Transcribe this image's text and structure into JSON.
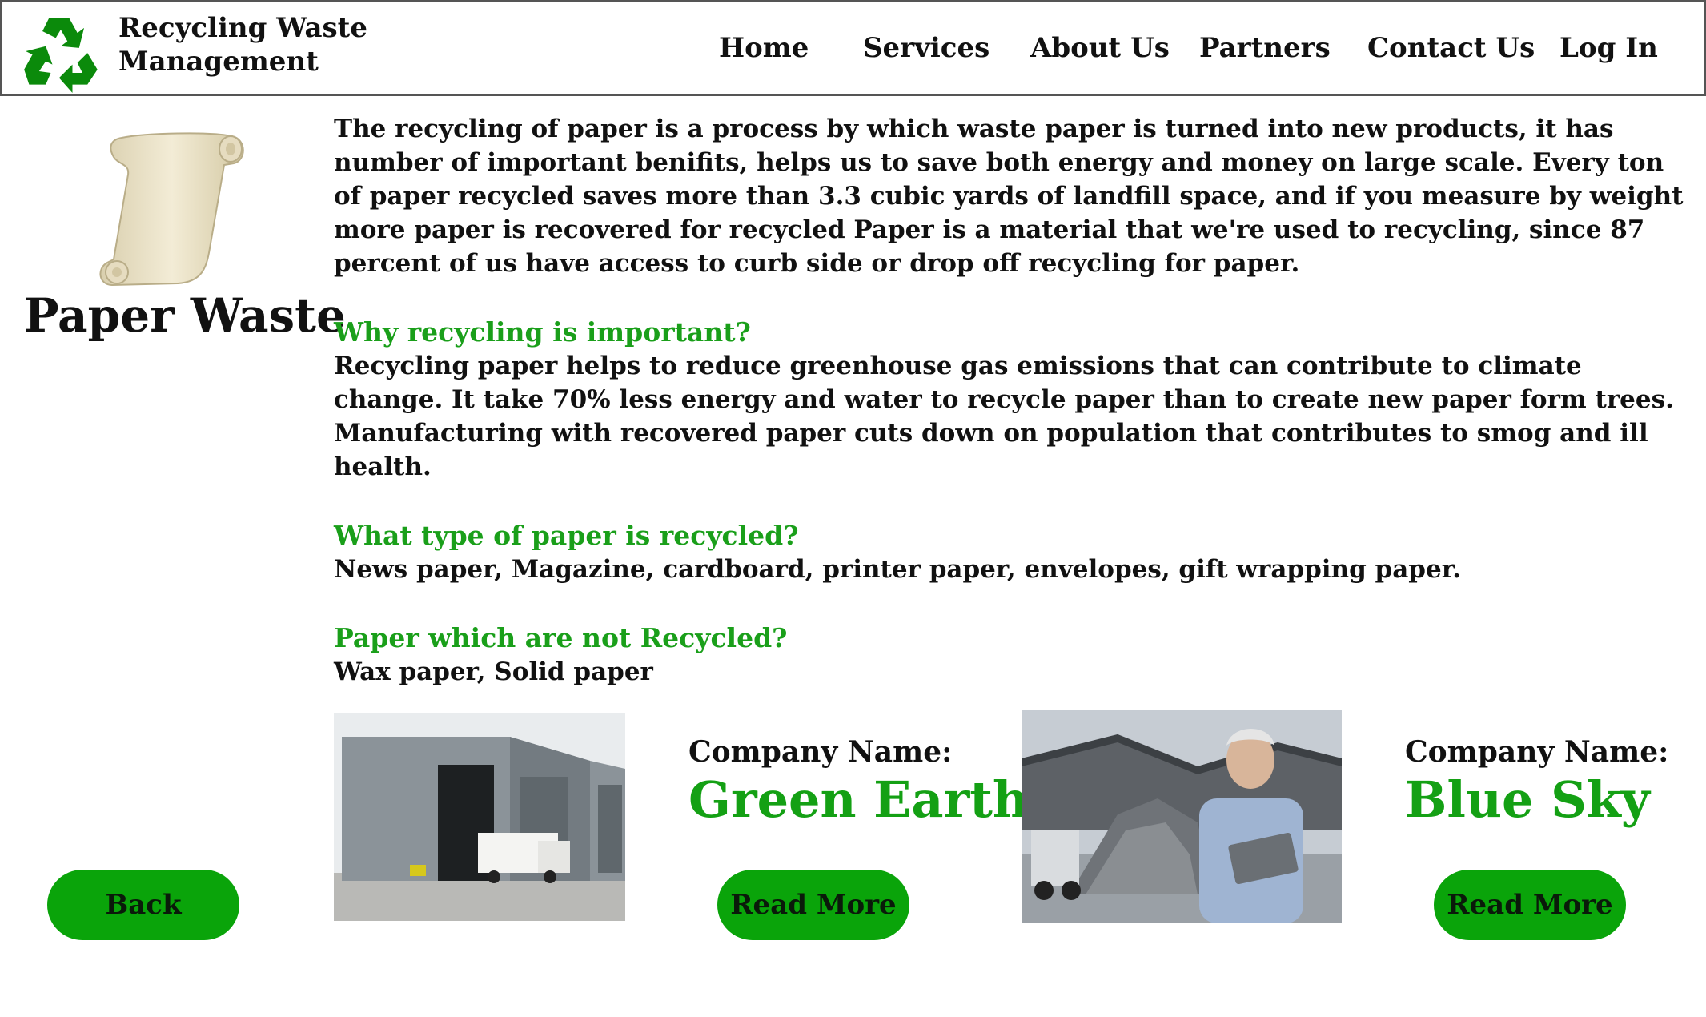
{
  "brand": {
    "line1": "Recycling Waste",
    "line2": "Management"
  },
  "nav": [
    "Home",
    "Services",
    "About Us",
    "Partners",
    "Contact Us",
    "Log In"
  ],
  "page_title": "Paper Waste",
  "intro": "The recycling of paper is a process by which waste paper is turned into new products, it has number of important benifits, helps us to save both energy and money on large scale.  Every ton of paper recycled saves more than 3.3 cubic yards of landfill space, and if you measure by weight more paper is recovered for recycled Paper is a material that we're used to recycling, since 87 percent of us have access to curb side or drop off recycling for paper.",
  "sections": [
    {
      "heading": "Why recycling is important?",
      "text": "Recycling paper helps to reduce greenhouse gas emissions that can contribute to climate change. It take 70% less energy and water to recycle paper than to create new paper form trees. Manufacturing with recovered paper cuts down on population that contributes to smog and ill health."
    },
    {
      "heading": "What type of paper is recycled?",
      "text": "News paper, Magazine, cardboard, printer paper, envelopes, gift wrapping paper."
    },
    {
      "heading": "Paper which are not Recycled?",
      "text": "Wax paper, Solid paper"
    }
  ],
  "companies": [
    {
      "label": "Company Name:",
      "name": "Green Earth",
      "button": "Read More"
    },
    {
      "label": "Company Name:",
      "name": "Blue Sky",
      "button": "Read More"
    }
  ],
  "back_button": "Back",
  "colors": {
    "accent_green": "#14a014",
    "button_green": "#0aa40a",
    "logo_green": "#0b8a0b"
  },
  "icons": {
    "logo": "recycle-icon",
    "illustration": "paper-scroll-icon"
  }
}
